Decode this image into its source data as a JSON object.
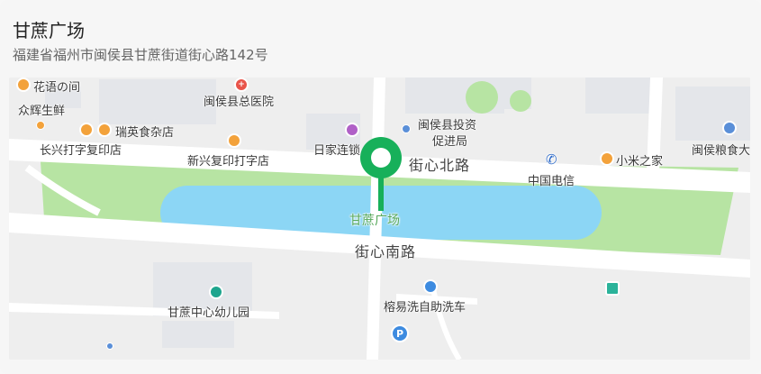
{
  "place": {
    "name": "甘蔗广场",
    "address": "福建省福州市闽侯县甘蔗街道街心路142号"
  },
  "map": {
    "accent_color": "#17b05a",
    "water_color": "#8cd6f5",
    "park_color": "#b7e4a3",
    "area_label": "甘蔗广场",
    "roads": {
      "north": "街心北路",
      "south": "街心南路"
    },
    "pois": {
      "huayu": "花语の间",
      "zhonghui": "众辉生鲜",
      "hospital": "闽侯县总医院",
      "riyi": "日家连锁",
      "touzi_line1": "闽侯县投资",
      "touzi_line2": "促进局",
      "ruiying": "瑞英食杂店",
      "changxing": "长兴打字复印店",
      "xinxing": "新兴复印打字店",
      "telecom": "中国电信",
      "xiaomi": "小米之家",
      "grain": "闽侯粮食大",
      "kindergarten": "甘蔗中心幼儿园",
      "carwash": "榕易洗自助洗车",
      "parking": "P"
    }
  }
}
